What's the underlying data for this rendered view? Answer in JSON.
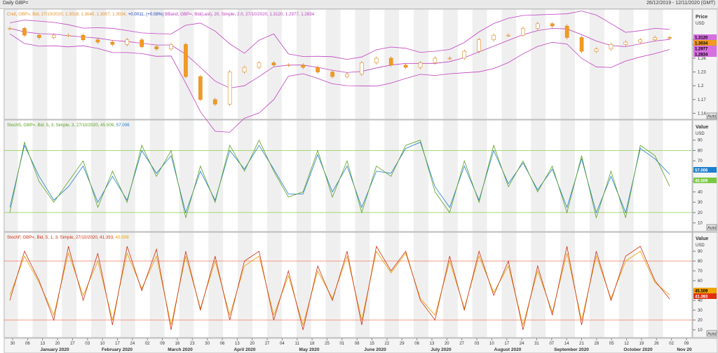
{
  "header": {
    "title": "Daily GBP=",
    "date_range": "26/12/2019 - 12/11/2020 (GMT)"
  },
  "panels": {
    "price": {
      "legend": [
        {
          "text": "Cndl, GBP=, Bid, 27/10/2020, 1.3018, 1.3040, 1.3007, 1.3034,",
          "color": "#e8902a"
        },
        {
          "text": "+0.0011,",
          "color": "#1f3fbf"
        },
        {
          "text": "(+0.08%)",
          "color": "#1f3fbf"
        },
        {
          "text": "BBand, GBP=, Bid(Last), 20, Simple, 2.0, 27/10/2020, 1.3120, 1.2977, 1.2834",
          "color": "#c040c0"
        }
      ],
      "axis_title": "Price",
      "axis_unit": "USD",
      "ticks": [
        "1.3",
        "1.29",
        "1.26",
        "1.23",
        "1.2",
        "1.17",
        "1.14"
      ],
      "last_labels": [
        {
          "text": "1.3120",
          "bg": "#d66fe0",
          "fg": "#000"
        },
        {
          "text": "1.3034",
          "bg": "#f29a20",
          "fg": "#000"
        },
        {
          "text": "1.2977",
          "bg": "#d66fe0",
          "fg": "#000"
        },
        {
          "text": "1.2834",
          "bg": "#d66fe0",
          "fg": "#000"
        }
      ],
      "auto": "Auto"
    },
    "stoch_slow": {
      "legend": [
        {
          "text": "StochS, GBP=, Bid, 5, 3, Simple, 3, 27/10/2020, 45.509,",
          "color": "#5aa020"
        },
        {
          "text": "57.006",
          "color": "#1f7fd0"
        }
      ],
      "axis_title": "Value",
      "axis_unit": "USD",
      "ticks": [
        "90",
        "80",
        "70",
        "60",
        "50",
        "40",
        "30",
        "20",
        "10"
      ],
      "last_labels": [
        {
          "text": "57.006",
          "bg": "#1f7fd0",
          "fg": "#fff"
        },
        {
          "text": "45.509",
          "bg": "#7ac943",
          "fg": "#fff"
        }
      ],
      "auto": "Auto"
    },
    "stoch_fast": {
      "legend": [
        {
          "text": "StochF, GBP=, Bid, 5, 1, 3, Simple, 27/10/2020, 41.393,",
          "color": "#d03010"
        },
        {
          "text": "45.509",
          "color": "#e8a000"
        }
      ],
      "axis_title": "Value",
      "axis_unit": "USD",
      "ticks": [
        "90",
        "80",
        "70",
        "60",
        "50",
        "40",
        "30",
        "20",
        "10"
      ],
      "last_labels": [
        {
          "text": "45.509",
          "bg": "#f0a500",
          "fg": "#000"
        },
        {
          "text": "41.393",
          "bg": "#e03010",
          "fg": "#fff"
        }
      ],
      "auto": "Auto"
    }
  },
  "x_axis": {
    "day_ticks": [
      "30",
      "06",
      "13",
      "20",
      "27",
      "03",
      "10",
      "17",
      "24",
      "02",
      "09",
      "16",
      "23",
      "30",
      "06",
      "13",
      "20",
      "27",
      "04",
      "11",
      "18",
      "25",
      "01",
      "08",
      "15",
      "22",
      "29",
      "06",
      "13",
      "20",
      "27",
      "03",
      "10",
      "17",
      "24",
      "31",
      "07",
      "14",
      "21",
      "28",
      "05",
      "12",
      "19",
      "26",
      "02",
      "09"
    ],
    "months": [
      "January 2020",
      "February 2020",
      "March 2020",
      "April 2020",
      "May 2020",
      "June 2020",
      "July 2020",
      "August 2020",
      "September 2020",
      "October 2020",
      "Nov 20"
    ]
  },
  "chart_data": [
    {
      "type": "candlestick",
      "title": "Cndl, GBP=, Bid",
      "x_start": "2019-12-30",
      "x_end": "2020-10-27",
      "ylim": [
        1.13,
        1.35
      ],
      "y_ticks": [
        1.3,
        1.29,
        1.26,
        1.23,
        1.2,
        1.17,
        1.14
      ],
      "close_by_week": [
        1.325,
        1.31,
        1.305,
        1.31,
        1.31,
        1.3,
        1.295,
        1.29,
        1.3,
        1.285,
        1.28,
        1.29,
        1.22,
        1.17,
        1.16,
        1.23,
        1.24,
        1.25,
        1.245,
        1.245,
        1.24,
        1.23,
        1.22,
        1.225,
        1.25,
        1.26,
        1.245,
        1.24,
        1.25,
        1.26,
        1.26,
        1.275,
        1.3,
        1.31,
        1.31,
        1.325,
        1.335,
        1.33,
        1.305,
        1.275,
        1.28,
        1.29,
        1.295,
        1.3,
        1.305,
        1.3034
      ],
      "last": {
        "date": "27/10/2020",
        "open": 1.3018,
        "high": 1.304,
        "low": 1.3007,
        "close": 1.3034,
        "change": 0.0011,
        "change_pct": 0.08
      }
    },
    {
      "type": "line",
      "title": "BBand, GBP=, Bid(Last), 20, Simple, 2.0",
      "series": [
        {
          "name": "BBand upper",
          "last": 1.312
        },
        {
          "name": "BBand middle",
          "last": 1.2977
        },
        {
          "name": "BBand lower",
          "last": 1.2834
        }
      ]
    },
    {
      "type": "line",
      "title": "StochS, GBP=, Bid, 5, 3, Simple, 3",
      "ylim": [
        5,
        100
      ],
      "reference_lines": [
        80,
        20
      ],
      "series": [
        {
          "name": "%K",
          "values": [
            20,
            88,
            50,
            30,
            50,
            70,
            25,
            60,
            30,
            85,
            55,
            80,
            15,
            65,
            30,
            85,
            60,
            90,
            60,
            35,
            40,
            80,
            35,
            70,
            20,
            65,
            55,
            85,
            90,
            40,
            20,
            70,
            30,
            85,
            45,
            70,
            40,
            65,
            20,
            75,
            15,
            60,
            15,
            85,
            75,
            45.509
          ]
        },
        {
          "name": "%D",
          "values": [
            25,
            85,
            55,
            32,
            45,
            65,
            30,
            55,
            32,
            80,
            58,
            75,
            20,
            60,
            32,
            80,
            62,
            85,
            62,
            38,
            38,
            76,
            40,
            65,
            25,
            60,
            58,
            82,
            88,
            45,
            25,
            65,
            32,
            80,
            48,
            68,
            42,
            62,
            25,
            72,
            20,
            55,
            20,
            82,
            72,
            57.006
          ]
        }
      ]
    },
    {
      "type": "line",
      "title": "StochF, GBP=, Bid, 5, 1, 3, Simple",
      "ylim": [
        5,
        100
      ],
      "reference_lines": [
        80,
        20
      ],
      "series": [
        {
          "name": "%K",
          "values": [
            40,
            90,
            60,
            20,
            95,
            40,
            88,
            15,
            95,
            50,
            92,
            10,
            90,
            30,
            85,
            20,
            80,
            90,
            20,
            70,
            10,
            75,
            40,
            90,
            15,
            95,
            70,
            90,
            40,
            20,
            85,
            30,
            90,
            45,
            80,
            10,
            75,
            25,
            95,
            15,
            90,
            40,
            85,
            95,
            60,
            41.393
          ]
        },
        {
          "name": "%D",
          "values": [
            45,
            85,
            58,
            25,
            88,
            45,
            80,
            20,
            88,
            52,
            85,
            15,
            85,
            32,
            80,
            25,
            75,
            85,
            25,
            65,
            15,
            70,
            42,
            85,
            20,
            90,
            68,
            88,
            42,
            25,
            80,
            32,
            85,
            48,
            75,
            15,
            70,
            28,
            88,
            20,
            85,
            42,
            80,
            90,
            58,
            45.509
          ]
        }
      ]
    }
  ]
}
